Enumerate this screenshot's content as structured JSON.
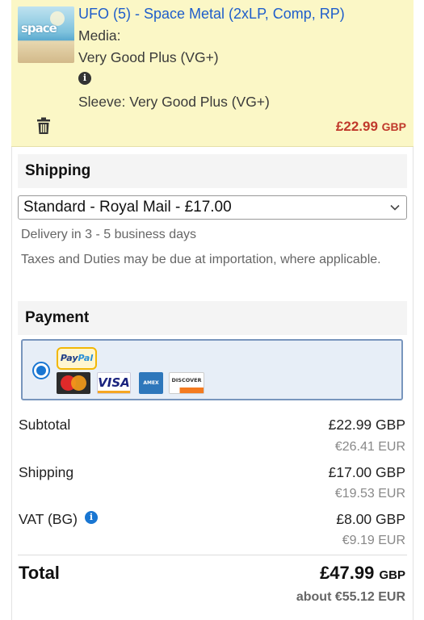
{
  "item": {
    "title": "UFO (5) - Space Metal (2xLP, Comp, RP)",
    "media_label": "Media:",
    "media_condition": "Very Good Plus (VG+)",
    "sleeve": "Sleeve: Very Good Plus (VG+)",
    "price": "£22.99",
    "price_currency": "GBP",
    "thumb_text": "space",
    "price_color": "#c0392b"
  },
  "shipping": {
    "heading": "Shipping",
    "selected_option": "Standard - Royal Mail - £17.00",
    "delivery": "Delivery in 3 - 5 business days",
    "taxes_note": "Taxes and Duties may be due at importation, where applicable."
  },
  "payment": {
    "heading": "Payment",
    "method": "PayPal",
    "cards": [
      "MasterCard",
      "VISA",
      "AMERICAN EXPRESS",
      "DISCOVER"
    ],
    "selected": true
  },
  "summary": {
    "subtotal_label": "Subtotal",
    "subtotal_gbp": "£22.99 GBP",
    "subtotal_eur": "€26.41 EUR",
    "shipping_label": "Shipping",
    "shipping_gbp": "£17.00 GBP",
    "shipping_eur": "€19.53 EUR",
    "vat_label": "VAT (BG)",
    "vat_gbp": "£8.00 GBP",
    "vat_eur": "€9.19 EUR",
    "total_label": "Total",
    "total_gbp": "£47.99",
    "total_currency": "GBP",
    "total_eur": "about €55.12 EUR"
  },
  "colors": {
    "link": "#1f5ecb",
    "item_bg": "#fbf7c6",
    "accent": "#1976d2"
  },
  "icons": [
    "info-icon",
    "trash-icon",
    "chevron-down-icon",
    "radio-selected-icon",
    "paypal-logo",
    "mastercard-logo",
    "visa-logo",
    "amex-logo",
    "discover-logo"
  ]
}
